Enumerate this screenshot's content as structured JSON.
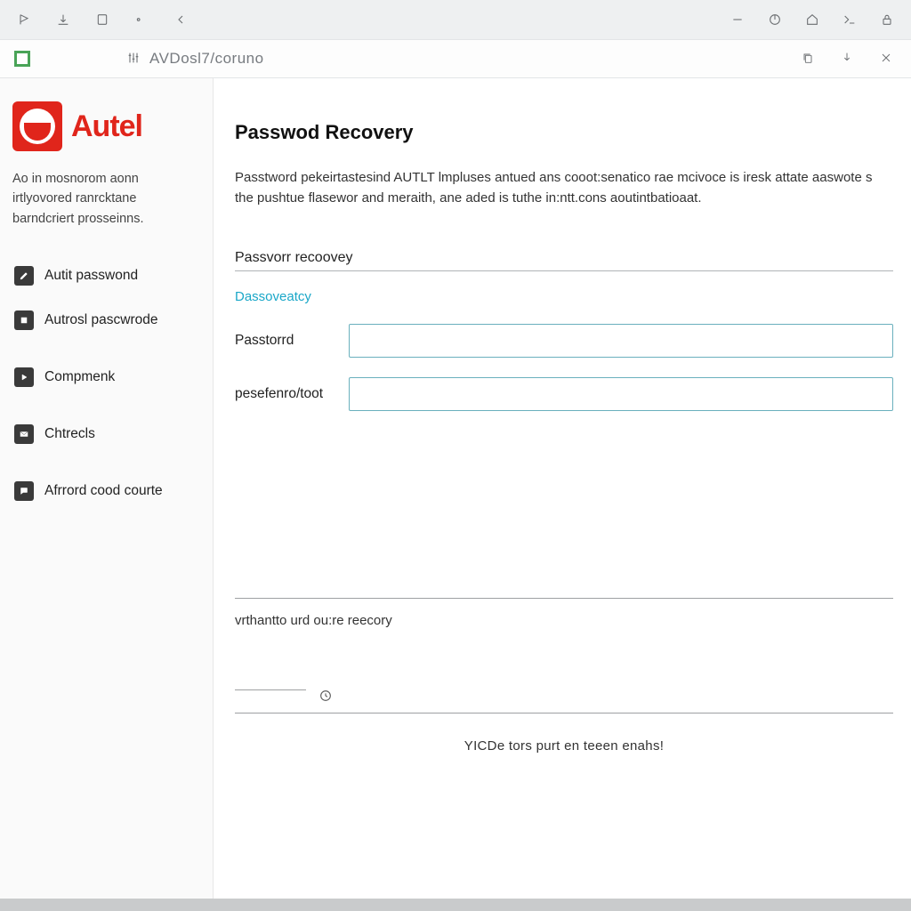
{
  "window": {
    "url": "AVDosl7/coruno"
  },
  "brand": {
    "name": "Autel",
    "tagline": "Ao in mosnorom aonn irtlyovored ranrcktane barndcriert prosseinns."
  },
  "sidebar": {
    "items": [
      {
        "label": "Autit passwond",
        "icon": "edit"
      },
      {
        "label": "Autrosl pascwrode",
        "icon": "square"
      },
      {
        "label": "Compmenk",
        "icon": "play"
      },
      {
        "label": "Chtrecls",
        "icon": "mail"
      },
      {
        "label": "Afrrord cood courte",
        "icon": "bubble"
      }
    ]
  },
  "main": {
    "title": "Passwod Recovery",
    "intro": "Passtword pekeirtastesind AUTLT lmpluses antued ans cooot:senatico rae mcivoce is iresk attate aaswote s the pushtue flasewor and meraith, ane aded is tuthe in:ntt.cons aoutintbatioaat.",
    "section_label": "Passvorr recoovey",
    "link_label": "Dassoveatcy",
    "field1_label": "Passtorrd",
    "field2_label": "pesefenro/toot",
    "lower_label": "vrthantto urd ou:re reecory",
    "footnote": "YICDe tors purt en teeen enahs!"
  }
}
